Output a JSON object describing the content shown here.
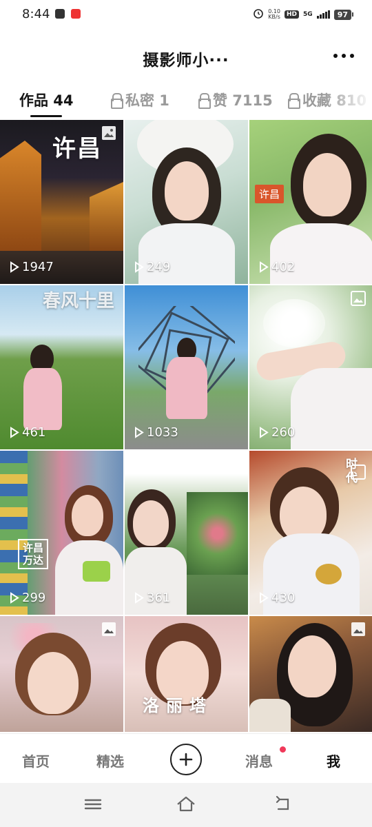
{
  "status_bar": {
    "time": "8:44",
    "net_speed_value": "0.10",
    "net_speed_unit": "KB/s",
    "hd_label": "HD",
    "network_label": "5G",
    "battery": "97"
  },
  "header": {
    "title": "摄影师小···",
    "more_icon": "more-horizontal-icon"
  },
  "tabs": [
    {
      "label": "作品 44",
      "active": true
    },
    {
      "label": "私密 1",
      "locked": true
    },
    {
      "label": "赞 7115",
      "locked": true
    },
    {
      "label": "收藏 810",
      "locked": true
    }
  ],
  "grid": {
    "tiles": [
      {
        "views": "1947",
        "overlay": "许昌",
        "has_image_icon": true
      },
      {
        "views": "249"
      },
      {
        "views": "402",
        "tag": "许昌"
      },
      {
        "views": "461",
        "overlay": "春风十里"
      },
      {
        "views": "1033"
      },
      {
        "views": "260",
        "has_image_icon": true
      },
      {
        "views": "299",
        "overlay": "许昌万达"
      },
      {
        "views": "361",
        "has_image_icon": true
      },
      {
        "views": "430",
        "overlay": "时代",
        "has_image_icon": true
      },
      {
        "views": "",
        "has_image_icon": true
      },
      {
        "views": "",
        "overlay": "洛丽塔"
      },
      {
        "views": "",
        "has_image_icon": true
      }
    ]
  },
  "bottom_nav": {
    "home": "首页",
    "featured": "精选",
    "messages": "消息",
    "me": "我",
    "add_icon": "plus-circle-icon",
    "accent": "#f0395a"
  },
  "system_nav": {
    "menu_icon": "menu-icon",
    "home_icon": "home-icon",
    "back_icon": "back-icon"
  }
}
